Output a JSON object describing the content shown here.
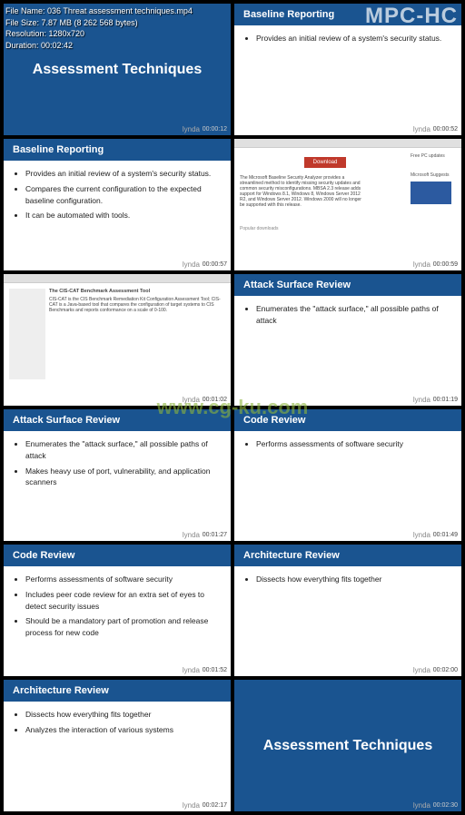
{
  "app": {
    "title": "MPC-HC"
  },
  "fileInfo": {
    "name": "File Name: 036 Threat assessment techniques.mp4",
    "size": "File Size: 7.87 MB (8 262 568 bytes)",
    "resolution": "Resolution: 1280x720",
    "duration": "Duration: 00:02:42"
  },
  "watermark": "www.cg-ku.com",
  "cells": [
    {
      "type": "title",
      "title": "Assessment Techniques",
      "timestamp": "00:00:12",
      "lynda": "lynda"
    },
    {
      "type": "slide",
      "header": "Baseline Reporting",
      "bullets": [
        "Provides an initial review of a system's security status."
      ],
      "timestamp": "00:00:52",
      "lynda": "lynda"
    },
    {
      "type": "slide",
      "header": "Baseline Reporting",
      "bullets": [
        "Provides an initial review of a system's security status.",
        "Compares the current configuration to the expected baseline configuration.",
        "It can be automated with tools."
      ],
      "timestamp": "00:00:57",
      "lynda": "lynda"
    },
    {
      "type": "browser1",
      "redBtn": "Download",
      "text": "The Microsoft Baseline Security Analyzer provides a streamlined method to identify missing security updates and common security misconfigurations. MBSA 2.3 release adds support for Windows 8.1, Windows 8, Windows Server 2012 R2, and Windows Server 2012. Windows 2000 will no longer be supported with this release.",
      "sideLabel1": "Free PC updates",
      "sideLabel2": "Microsoft Suggests",
      "popular": "Popular downloads",
      "timestamp": "00:00:59",
      "lynda": "lynda"
    },
    {
      "type": "browser2",
      "heading": "The CIS-CAT Benchmark Assessment Tool",
      "text": "CIS-CAT is the CIS Benchmark Remediation Kit Configuration Assessment Tool; CIS-CAT is a Java-based tool that compares the configuration of target systems to CIS Benchmarks and reports conformance on a scale of 0-100.",
      "timestamp": "00:01:02",
      "lynda": "lynda"
    },
    {
      "type": "slide",
      "header": "Attack Surface Review",
      "bullets": [
        "Enumerates the \"attack surface,\" all possible paths of attack"
      ],
      "timestamp": "00:01:19",
      "lynda": "lynda"
    },
    {
      "type": "slide",
      "header": "Attack Surface Review",
      "bullets": [
        "Enumerates the \"attack surface,\" all possible paths of attack",
        "Makes heavy use of port, vulnerability, and application scanners"
      ],
      "timestamp": "00:01:27",
      "lynda": "lynda"
    },
    {
      "type": "slide",
      "header": "Code Review",
      "bullets": [
        "Performs assessments of software security"
      ],
      "timestamp": "00:01:49",
      "lynda": "lynda"
    },
    {
      "type": "slide",
      "header": "Code Review",
      "bullets": [
        "Performs assessments of software security",
        "Includes peer code review for an extra set of eyes to detect security issues",
        "Should be a mandatory part of promotion and release process for new code"
      ],
      "timestamp": "00:01:52",
      "lynda": "lynda"
    },
    {
      "type": "slide",
      "header": "Architecture Review",
      "bullets": [
        "Dissects how everything fits together"
      ],
      "timestamp": "00:02:00",
      "lynda": "lynda"
    },
    {
      "type": "slide",
      "header": "Architecture Review",
      "bullets": [
        "Dissects how everything fits together",
        "Analyzes the interaction of various systems"
      ],
      "timestamp": "00:02:17",
      "lynda": "lynda"
    },
    {
      "type": "title",
      "title": "Assessment Techniques",
      "timestamp": "00:02:30",
      "lynda": "lynda"
    }
  ]
}
